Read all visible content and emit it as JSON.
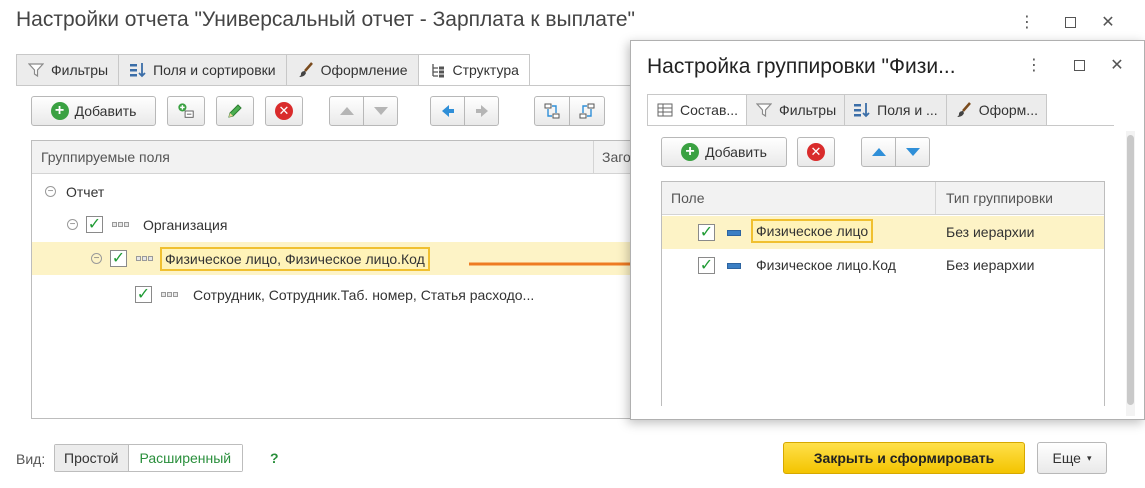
{
  "main": {
    "title": "Настройки отчета \"Универсальный отчет - Зарплата к выплате\"",
    "tabs": [
      {
        "label": "Фильтры",
        "icon": "filter-icon"
      },
      {
        "label": "Поля и сортировки",
        "icon": "fields-sort-icon"
      },
      {
        "label": "Оформление",
        "icon": "brush-icon"
      },
      {
        "label": "Структура",
        "icon": "structure-icon"
      }
    ],
    "toolbar": {
      "add_label": "Добавить"
    },
    "grid": {
      "col_fields": "Группируемые поля",
      "col_title": "Заго",
      "rows": [
        {
          "label": "Отчет"
        },
        {
          "label": "Организация",
          "checked": true
        },
        {
          "label": "Физическое лицо, Физическое лицо.Код",
          "checked": true,
          "selected": true
        },
        {
          "label": "Сотрудник, Сотрудник.Таб. номер, Статья расходо...",
          "checked": true
        }
      ]
    },
    "footer": {
      "view_label": "Вид:",
      "view_simple": "Простой",
      "view_extended": "Расширенный",
      "help": "?",
      "close_generate": "Закрыть и сформировать",
      "more": "Еще"
    }
  },
  "dialog": {
    "title": "Настройка группировки \"Физи...",
    "tabs": [
      {
        "label": "Состав...",
        "icon": "table-icon"
      },
      {
        "label": "Фильтры",
        "icon": "filter-icon"
      },
      {
        "label": "Поля и ...",
        "icon": "fields-sort-icon"
      },
      {
        "label": "Оформ...",
        "icon": "brush-icon"
      }
    ],
    "toolbar": {
      "add_label": "Добавить"
    },
    "grid": {
      "col_field": "Поле",
      "col_type": "Тип группировки",
      "rows": [
        {
          "field": "Физическое лицо",
          "type": "Без иерархии",
          "checked": true,
          "selected": true
        },
        {
          "field": "Физическое лицо.Код",
          "type": "Без иерархии",
          "checked": true
        }
      ]
    }
  },
  "colors": {
    "accent_yellow": "#f3c400",
    "selected_row": "#fdf3c6",
    "highlight_border": "#f0c030",
    "arrow": "#ee7b22",
    "check": "#1f9b34"
  }
}
